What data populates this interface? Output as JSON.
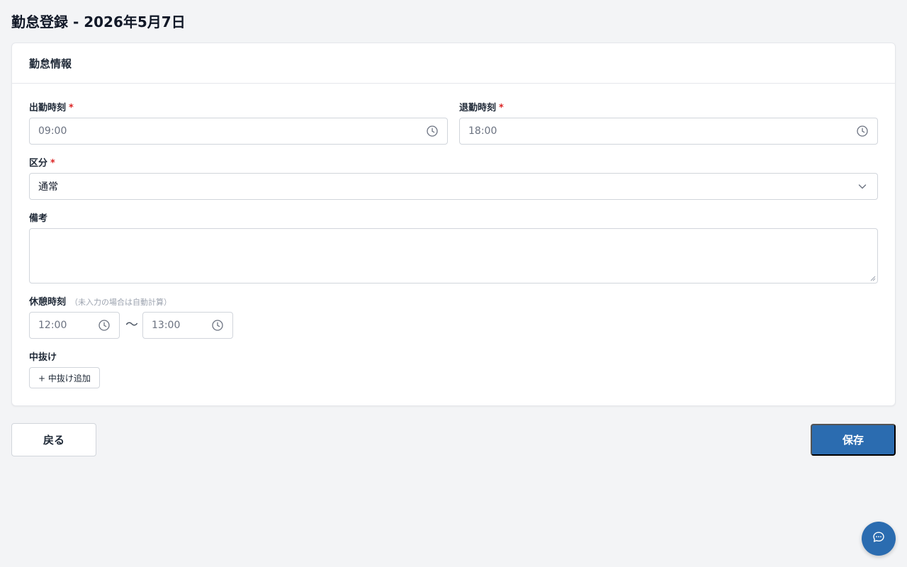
{
  "page": {
    "title": "勤怠登録 - 2026年5月7日"
  },
  "card": {
    "title": "勤怠情報"
  },
  "form": {
    "clock_in": {
      "label": "出勤時刻",
      "required_mark": "*",
      "value": "09:00",
      "icon": "clock-icon"
    },
    "clock_out": {
      "label": "退勤時刻",
      "required_mark": "*",
      "value": "18:00",
      "icon": "clock-icon"
    },
    "category": {
      "label": "区分",
      "required_mark": "*",
      "selected": "通常",
      "icon": "chevron-down-icon"
    },
    "remarks": {
      "label": "備考",
      "value": ""
    },
    "break_time": {
      "label": "休憩時刻",
      "hint": "（未入力の場合は自動計算）",
      "start": "12:00",
      "separator": "〜",
      "end": "13:00"
    },
    "interruption": {
      "label": "中抜け",
      "add_button": "+ 中抜け追加"
    }
  },
  "actions": {
    "back_label": "戻る",
    "save_label": "保存"
  },
  "chat": {
    "icon": "chat-bubble-icon"
  },
  "colors": {
    "primary": "#2b6cb0",
    "required": "#dc2626",
    "background": "#f3f4f6"
  }
}
